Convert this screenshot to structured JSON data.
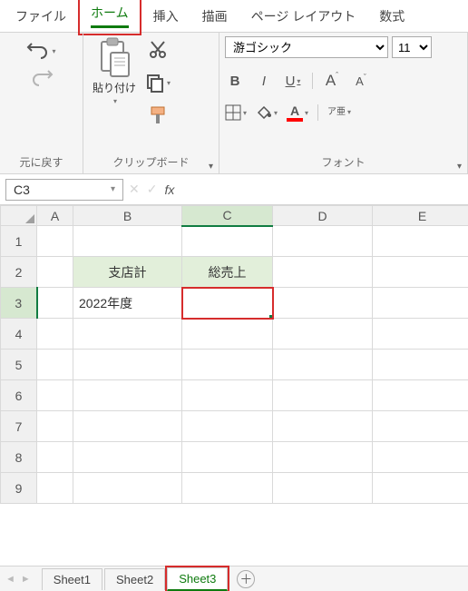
{
  "menu": {
    "tabs": [
      "ファイル",
      "ホーム",
      "挿入",
      "描画",
      "ページ レイアウト",
      "数式"
    ],
    "active_index": 1,
    "highlighted_index": 1
  },
  "ribbon": {
    "undo_group_label": "元に戻す",
    "clipboard": {
      "paste_label": "貼り付け",
      "group_label": "クリップボード"
    },
    "font": {
      "name": "游ゴシック",
      "size": "11",
      "bold": "B",
      "italic": "I",
      "underline": "U",
      "grow": "A",
      "shrink": "A",
      "ruby": "ア亜",
      "group_label": "フォント",
      "fill_color": "#ffff00",
      "font_color": "#ff0000"
    }
  },
  "namebox": "C3",
  "formula": "",
  "columns": [
    "A",
    "B",
    "C",
    "D",
    "E"
  ],
  "rows": [
    "1",
    "2",
    "3",
    "4",
    "5",
    "6",
    "7",
    "8",
    "9"
  ],
  "cells": {
    "B2": "支店計",
    "C2": "総売上",
    "B3": "2022年度"
  },
  "chart_data": {
    "type": "table",
    "headers": [
      "",
      "支店計",
      "総売上"
    ],
    "rows": [
      [
        "2022年度",
        "",
        ""
      ]
    ]
  },
  "selected_cell": "C3",
  "sheet_tabs": [
    "Sheet1",
    "Sheet2",
    "Sheet3"
  ],
  "active_sheet_index": 2,
  "highlighted_sheet_index": 2
}
